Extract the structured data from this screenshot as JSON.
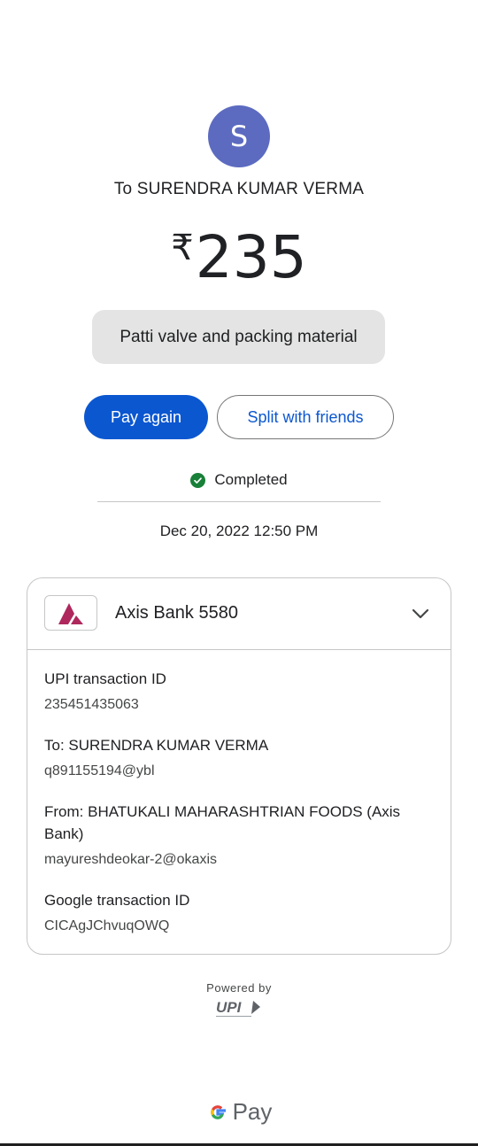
{
  "payee": {
    "avatar_letter": "S",
    "to_label": "To SURENDRA KUMAR VERMA"
  },
  "amount": {
    "currency_symbol": "₹",
    "value": "235"
  },
  "note": "Patti valve and packing material",
  "actions": {
    "pay_again": "Pay again",
    "split": "Split with friends"
  },
  "status": {
    "label": "Completed",
    "color": "#188038"
  },
  "datetime": "Dec 20, 2022 12:50 PM",
  "details": {
    "bank": "Axis Bank 5580",
    "upi_txn_label": "UPI transaction ID",
    "upi_txn_value": "235451435063",
    "to_label": "To: SURENDRA KUMAR VERMA",
    "to_value": "q891155194@ybl",
    "from_label": "From: BHATUKALI MAHARASHTRIAN FOODS (Axis Bank)",
    "from_value": "mayureshdeokar-2@okaxis",
    "google_txn_label": "Google transaction ID",
    "google_txn_value": "CICAgJChvuqOWQ"
  },
  "footer": {
    "powered_by": "Powered by",
    "upi_brand": "UPI",
    "gpay_text": "Pay"
  },
  "icons": {
    "status": "check-circle-icon",
    "expand": "chevron-down-icon",
    "bank": "axis-bank-logo",
    "google": "google-g-logo"
  },
  "colors": {
    "primary": "#0b57d0",
    "avatar": "#5c6bc0",
    "note_bg": "#e3e4e3",
    "axis_brand": "#ae285d"
  }
}
